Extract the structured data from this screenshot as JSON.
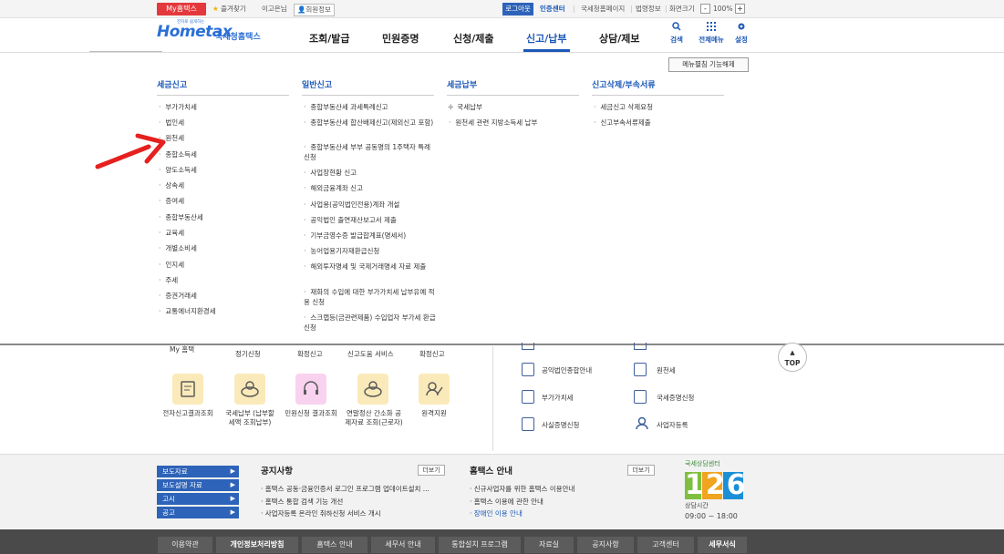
{
  "topbar": {
    "my_hometax": "My홈택스",
    "favorites": "즐겨찾기",
    "user_greeting": "이고은님",
    "member_info": "회원정보",
    "logout": "로그아웃",
    "cert_center": "인증센터",
    "nts_homepage": "국세청홈페이지",
    "law_info": "법령정보",
    "screen_size": "화면크기",
    "zoom_minus": "-",
    "zoom_value": "100%",
    "zoom_plus": "+"
  },
  "header": {
    "logo_text": "Hometax",
    "logo_tagline": "전자로 쉽게하는",
    "logo_org": "국세청홈택스",
    "nav": [
      "조회/발급",
      "민원증명",
      "신청/제출",
      "신고/납부",
      "상담/제보"
    ],
    "active_nav_index": 3,
    "icons": [
      {
        "icon": "search-icon",
        "label": "검색"
      },
      {
        "icon": "grid-menu-icon",
        "label": "전체메뉴"
      },
      {
        "icon": "gear-icon",
        "label": "설정"
      }
    ]
  },
  "megamenu": {
    "disable_button": "메뉴펼침 기능해제",
    "columns": [
      {
        "title": "세금신고",
        "items": [
          "부가가치세",
          "법인세",
          "원천세",
          "종합소득세",
          "양도소득세",
          "상속세",
          "증여세",
          "종합부동산세",
          "교육세",
          "개별소비세",
          "인지세",
          "주세",
          "증권거래세",
          "교통에너지환경세"
        ]
      },
      {
        "title": "일반신고",
        "items": [
          "종합부동산세 과세특례신고",
          "종합부동산세 합산배제신고(제외신고 포함)",
          "종합부동산세 부부 공동명의 1주택자 특례 신청",
          "사업장현황 신고",
          "해외금융계좌 신고",
          "사업용(공익법인전용)계좌 개설",
          "공익법인 출연재산보고서 제출",
          "기부금영수증 발급합계표(명세서)",
          "농어업용기자재환급신청",
          "해외투자명세 및 국제거래명세 자료 제출",
          "재화의 수입에 대한 부가가치세 납부유예 적용 신청",
          "스크랩등(금관련제품) 수입업자 부가세 환급신청"
        ]
      },
      {
        "title": "세금납부",
        "items": [
          "국세납부",
          "원천세 관련 지방소득세 납부"
        ]
      },
      {
        "title": "신고삭제/부속서류",
        "items": [
          "세금신고 삭제요청",
          "신고부속서류제출"
        ]
      }
    ]
  },
  "content": {
    "cut_labels": [
      "My 홈택",
      "정기신청",
      "확정신고",
      "신고도움 서비스",
      "확정신고"
    ],
    "services": [
      {
        "label": "전자신고결과조회",
        "icon": "report-result-icon"
      },
      {
        "label": "국세납부 (납부할 세액 조회납부)",
        "icon": "tax-payment-icon"
      },
      {
        "label": "민원신청 결과조회",
        "icon": "headset-icon"
      },
      {
        "label": "연말정산 간소화 공제자료 조회(근로자)",
        "icon": "year-end-icon"
      },
      {
        "label": "원격지원",
        "icon": "remote-support-icon"
      }
    ],
    "right_links": [
      {
        "label": "공익법인종합안내",
        "icon": "clipboard-icon"
      },
      {
        "label": "원천세",
        "icon": "document-icon"
      },
      {
        "label": "부가가치세",
        "icon": "vat-icon"
      },
      {
        "label": "국세증명신청",
        "icon": "certificate-icon"
      },
      {
        "label": "사실증명신청",
        "icon": "form-icon"
      },
      {
        "label": "사업자등록",
        "icon": "person-icon"
      }
    ],
    "top_button": "TOP"
  },
  "notice": {
    "press_buttons": [
      "보도자료",
      "보도설명 자료",
      "고시",
      "공고"
    ],
    "announcements": {
      "title": "공지사항",
      "more": "더보기",
      "items": [
        "홈택스 공동·금융인증서 로그인 프로그램 업데이트설치 ...",
        "홈택스 통합 검색 기능 개선",
        "사업자등록 온라인 취하신청 서비스 개시"
      ]
    },
    "guide": {
      "title": "홈택스 안내",
      "more": "더보기",
      "items": [
        "신규사업자를 위한 홈택스 이용안내",
        "홈택스 이용에 관한 안내",
        "장애인 이용 안내"
      ]
    },
    "call_center": {
      "tagline": "국세상담센터",
      "number": "126",
      "hours_label": "상담시간",
      "hours": "09:00 ~ 18:00"
    }
  },
  "footer": {
    "links": [
      "이용약관",
      "개인정보처리방침",
      "홈택스 안내",
      "세무서 안내",
      "통합설치 프로그램",
      "자료실",
      "공지사항",
      "고객센터",
      "세무서식"
    ]
  }
}
